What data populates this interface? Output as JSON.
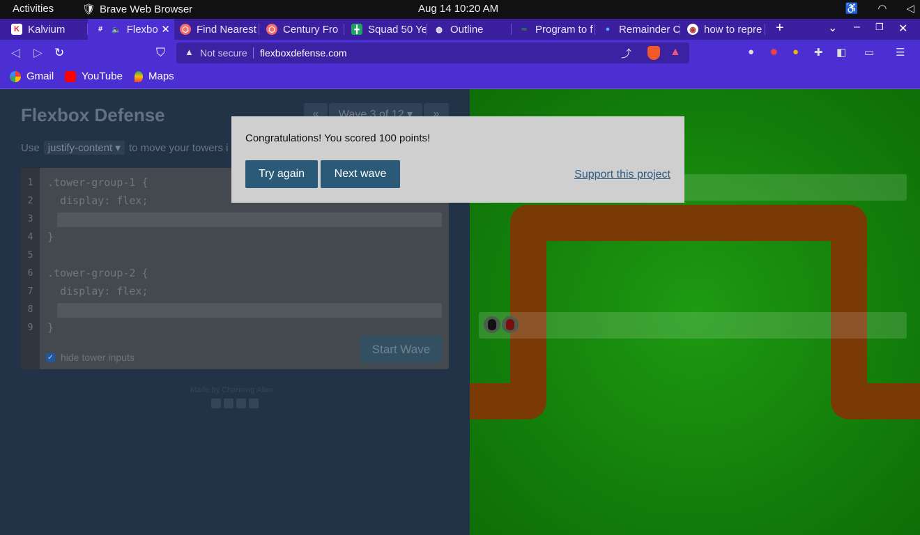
{
  "os": {
    "activities": "Activities",
    "app_name": "Brave Web Browser",
    "clock": "Aug 14  10:20 AM"
  },
  "tabs": [
    {
      "label": "Kalvium"
    },
    {
      "label": "Flexbo"
    },
    {
      "label": "Find Nearest"
    },
    {
      "label": "Century Fro"
    },
    {
      "label": "Squad 50 Ye"
    },
    {
      "label": "Outline"
    },
    {
      "label": "Program to f"
    },
    {
      "label": "Remainder C"
    },
    {
      "label": "how to repre"
    }
  ],
  "address": {
    "security": "Not secure",
    "url": "flexboxdefense.com",
    "shields_count": "1"
  },
  "bookmarks": [
    {
      "label": "Gmail"
    },
    {
      "label": "YouTube"
    },
    {
      "label": "Maps"
    }
  ],
  "game": {
    "title": "Flexbox Defense",
    "wave": "Wave 3 of 12 ▾",
    "prev": "«",
    "next": "»",
    "instruction_pre": "Use",
    "instruction_prop": "justify-content ▾",
    "instruction_post": "to move your towers i",
    "code_lines": [
      ".tower-group-1 {",
      "  display: flex;",
      "",
      "}",
      "",
      ".tower-group-2 {",
      "  display: flex;",
      "",
      "}"
    ],
    "line_numbers": [
      "1",
      "2",
      "3",
      "4",
      "5",
      "6",
      "7",
      "8",
      "9"
    ],
    "hide_inputs_label": "hide tower inputs",
    "start_wave": "Start Wave",
    "credit": "Made by Channing Allen"
  },
  "modal": {
    "message": "Congratulations! You scored 100 points!",
    "try_again": "Try again",
    "next_wave": "Next wave",
    "support": "Support this project"
  }
}
